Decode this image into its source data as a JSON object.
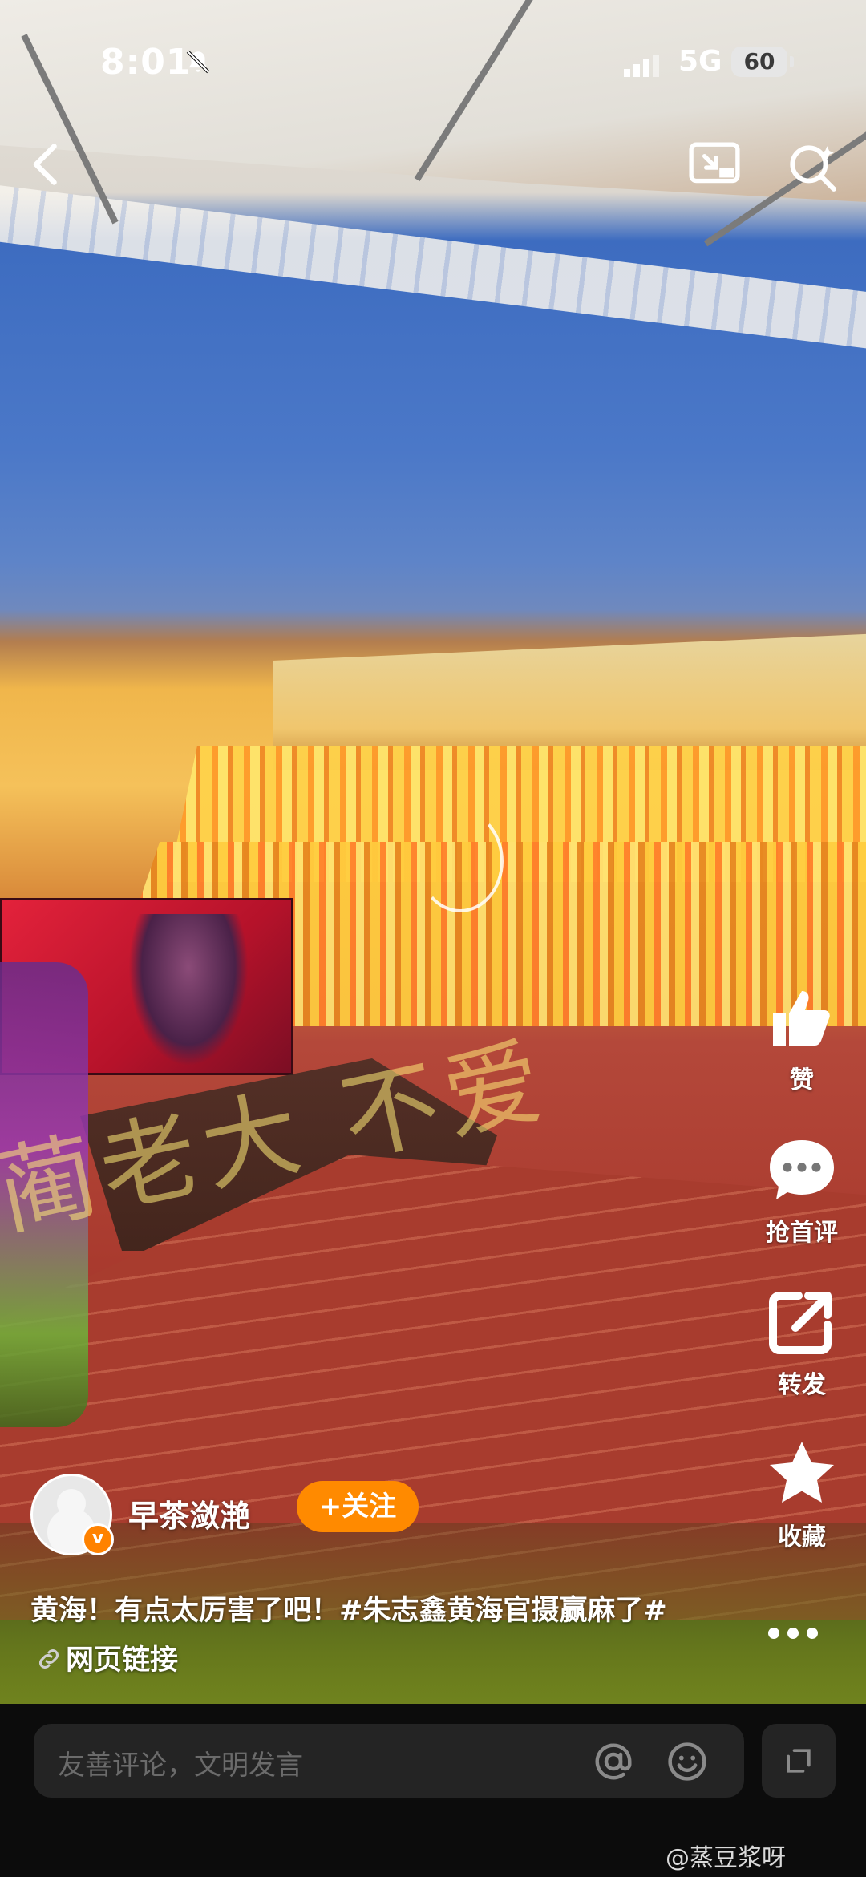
{
  "status_bar": {
    "time": "8:01",
    "network": "5G",
    "battery": "60"
  },
  "nav": {
    "back_icon": "chevron-left-icon",
    "cast_icon": "cast-screen-icon",
    "search_icon": "search-icon"
  },
  "video": {
    "watermark_text": "蔺老大 不爱"
  },
  "actions": {
    "like_label": "赞",
    "comment_label": "抢首评",
    "share_label": "转发",
    "favorite_label": "收藏"
  },
  "author": {
    "name": "早茶潋滟",
    "follow_label": "+关注",
    "verified_badge": "v"
  },
  "caption": {
    "text": "黄海！有点太厉害了吧！",
    "hashtag": "#朱志鑫黄海官摄赢麻了#",
    "link_label": "网页链接"
  },
  "comment_bar": {
    "placeholder": "友善评论，文明发言"
  },
  "source_watermark": "@蒸豆浆呀",
  "colors": {
    "accent": "#ff8a00",
    "bar_bg": "#0c0c0c",
    "input_bg": "#242424"
  }
}
